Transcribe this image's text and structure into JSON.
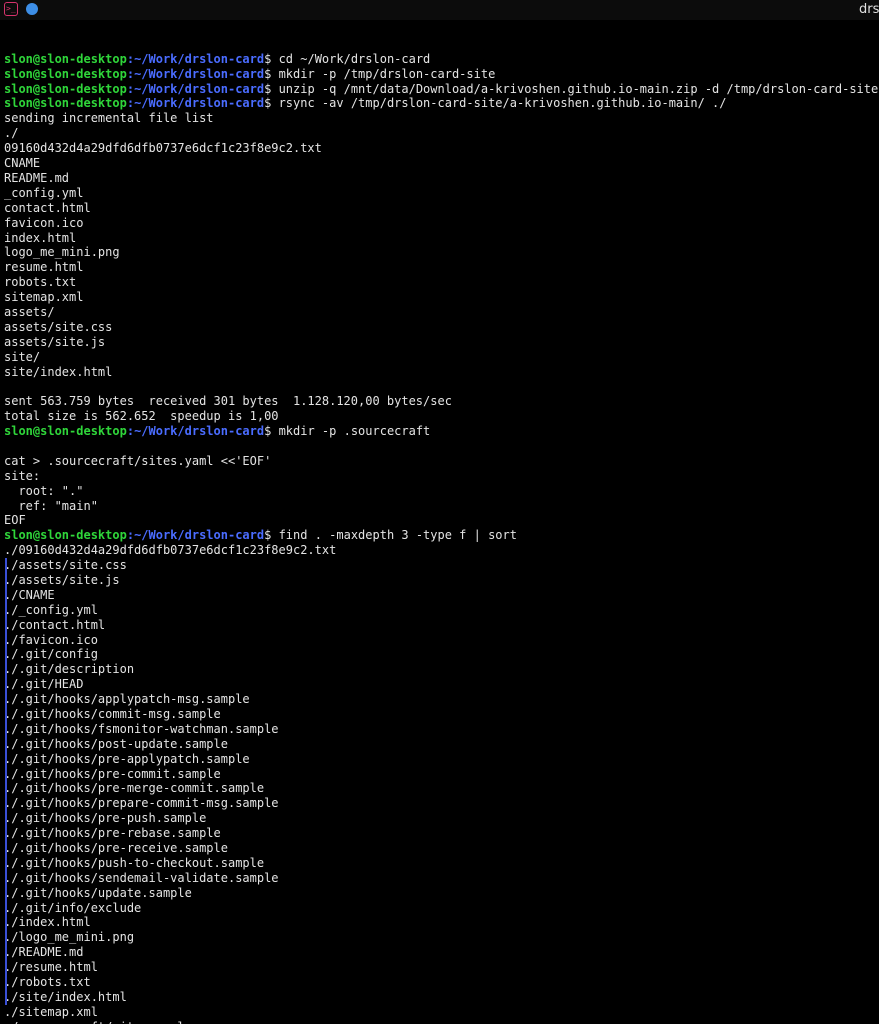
{
  "window": {
    "title": "drsl",
    "icons": [
      "terminal-icon",
      "globe-icon"
    ]
  },
  "prompt": {
    "user": "slon@slon-desktop",
    "sep": ":",
    "path": "~/Work/drslon-card",
    "dollar": "$"
  },
  "colors": {
    "background": "#000000",
    "text": "#e4e4e4",
    "prompt_user": "#2fd63a",
    "prompt_path": "#4a6cff"
  },
  "lines": [
    {
      "t": "cmd",
      "text": " cd ~/Work/drslon-card"
    },
    {
      "t": "cmd",
      "text": " mkdir -p /tmp/drslon-card-site"
    },
    {
      "t": "cmd",
      "text": " unzip -q /mnt/data/Download/a-krivoshen.github.io-main.zip -d /tmp/drslon-card-site"
    },
    {
      "t": "cmd",
      "text": " rsync -av /tmp/drslon-card-site/a-krivoshen.github.io-main/ ./"
    },
    {
      "t": "out",
      "text": "sending incremental file list"
    },
    {
      "t": "out",
      "text": "./"
    },
    {
      "t": "out",
      "text": "09160d432d4a29dfd6dfb0737e6dcf1c23f8e9c2.txt"
    },
    {
      "t": "out",
      "text": "CNAME"
    },
    {
      "t": "out",
      "text": "README.md"
    },
    {
      "t": "out",
      "text": "_config.yml"
    },
    {
      "t": "out",
      "text": "contact.html"
    },
    {
      "t": "out",
      "text": "favicon.ico"
    },
    {
      "t": "out",
      "text": "index.html"
    },
    {
      "t": "out",
      "text": "logo_me_mini.png"
    },
    {
      "t": "out",
      "text": "resume.html"
    },
    {
      "t": "out",
      "text": "robots.txt"
    },
    {
      "t": "out",
      "text": "sitemap.xml"
    },
    {
      "t": "out",
      "text": "assets/"
    },
    {
      "t": "out",
      "text": "assets/site.css"
    },
    {
      "t": "out",
      "text": "assets/site.js"
    },
    {
      "t": "out",
      "text": "site/"
    },
    {
      "t": "out",
      "text": "site/index.html"
    },
    {
      "t": "out",
      "text": ""
    },
    {
      "t": "out",
      "text": "sent 563.759 bytes  received 301 bytes  1.128.120,00 bytes/sec"
    },
    {
      "t": "out",
      "text": "total size is 562.652  speedup is 1,00"
    },
    {
      "t": "cmd",
      "text": " mkdir -p .sourcecraft"
    },
    {
      "t": "out",
      "text": ""
    },
    {
      "t": "out",
      "text": "cat > .sourcecraft/sites.yaml <<'EOF'"
    },
    {
      "t": "out",
      "text": "site:"
    },
    {
      "t": "out",
      "text": "  root: \".\""
    },
    {
      "t": "out",
      "text": "  ref: \"main\""
    },
    {
      "t": "out",
      "text": "EOF"
    },
    {
      "t": "cmd",
      "text": " find . -maxdepth 3 -type f | sort"
    },
    {
      "t": "out",
      "text": "./09160d432d4a29dfd6dfb0737e6dcf1c23f8e9c2.txt"
    },
    {
      "t": "out",
      "text": "./assets/site.css"
    },
    {
      "t": "out",
      "text": "./assets/site.js"
    },
    {
      "t": "out",
      "text": "./CNAME"
    },
    {
      "t": "out",
      "text": "./_config.yml"
    },
    {
      "t": "out",
      "text": "./contact.html"
    },
    {
      "t": "out",
      "text": "./favicon.ico"
    },
    {
      "t": "out",
      "text": "./.git/config"
    },
    {
      "t": "out",
      "text": "./.git/description"
    },
    {
      "t": "out",
      "text": "./.git/HEAD"
    },
    {
      "t": "out",
      "text": "./.git/hooks/applypatch-msg.sample"
    },
    {
      "t": "out",
      "text": "./.git/hooks/commit-msg.sample"
    },
    {
      "t": "out",
      "text": "./.git/hooks/fsmonitor-watchman.sample"
    },
    {
      "t": "out",
      "text": "./.git/hooks/post-update.sample"
    },
    {
      "t": "out",
      "text": "./.git/hooks/pre-applypatch.sample"
    },
    {
      "t": "out",
      "text": "./.git/hooks/pre-commit.sample"
    },
    {
      "t": "out",
      "text": "./.git/hooks/pre-merge-commit.sample"
    },
    {
      "t": "out",
      "text": "./.git/hooks/prepare-commit-msg.sample"
    },
    {
      "t": "out",
      "text": "./.git/hooks/pre-push.sample"
    },
    {
      "t": "out",
      "text": "./.git/hooks/pre-rebase.sample"
    },
    {
      "t": "out",
      "text": "./.git/hooks/pre-receive.sample"
    },
    {
      "t": "out",
      "text": "./.git/hooks/push-to-checkout.sample"
    },
    {
      "t": "out",
      "text": "./.git/hooks/sendemail-validate.sample"
    },
    {
      "t": "out",
      "text": "./.git/hooks/update.sample"
    },
    {
      "t": "out",
      "text": "./.git/info/exclude"
    },
    {
      "t": "out",
      "text": "./index.html"
    },
    {
      "t": "out",
      "text": "./logo_me_mini.png"
    },
    {
      "t": "out",
      "text": "./README.md"
    },
    {
      "t": "out",
      "text": "./resume.html"
    },
    {
      "t": "out",
      "text": "./robots.txt"
    },
    {
      "t": "out",
      "text": "./site/index.html"
    },
    {
      "t": "out",
      "text": "./sitemap.xml"
    },
    {
      "t": "out",
      "text": "./.sourcecraft/sites.yaml"
    },
    {
      "t": "cmd",
      "text": ""
    }
  ]
}
